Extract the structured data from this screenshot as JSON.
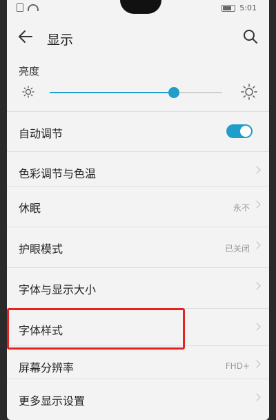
{
  "status_bar": {
    "time": "5:01"
  },
  "app_bar": {
    "title": "显示"
  },
  "brightness": {
    "label": "亮度",
    "level": 0.72
  },
  "rows": [
    {
      "label": "自动调节",
      "value": "",
      "type": "toggle",
      "on": true
    },
    {
      "label": "色彩调节与色温",
      "value": "",
      "type": "chevron"
    },
    {
      "label": "休眠",
      "value": "永不",
      "type": "chevron"
    },
    {
      "label": "护眼模式",
      "value": "已关闭",
      "type": "chevron"
    },
    {
      "label": "字体与显示大小",
      "value": "",
      "type": "chevron"
    },
    {
      "label": "字体样式",
      "value": "",
      "type": "chevron"
    },
    {
      "label": "屏幕分辨率",
      "value": "FHD+",
      "type": "chevron"
    },
    {
      "label": "更多显示设置",
      "value": "",
      "type": "chevron"
    }
  ],
  "colors": {
    "accent": "#1e9ec8",
    "highlight": "#e8201e"
  }
}
